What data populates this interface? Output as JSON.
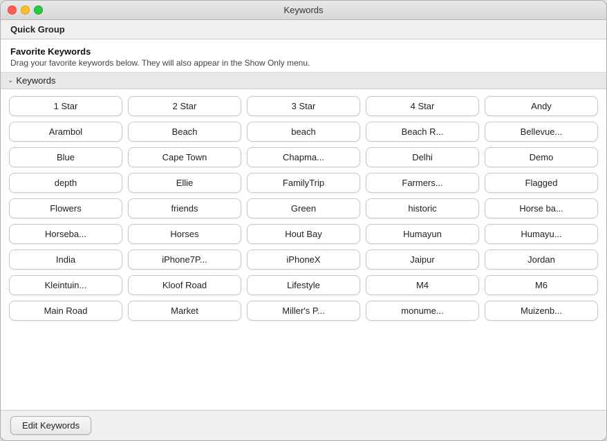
{
  "window": {
    "title": "Keywords"
  },
  "quick_group": {
    "label": "Quick Group"
  },
  "favorite_keywords": {
    "title": "Favorite Keywords",
    "description": "Drag your favorite keywords below. They will also appear in the Show Only menu."
  },
  "keywords_section": {
    "label": "Keywords",
    "chevron": "⌄"
  },
  "keywords": [
    "1 Star",
    "2 Star",
    "3 Star",
    "4 Star",
    "Andy",
    "Arambol",
    "Beach",
    "beach",
    "Beach R...",
    "Bellevue...",
    "Blue",
    "Cape Town",
    "Chapma...",
    "Delhi",
    "Demo",
    "depth",
    "Ellie",
    "FamilyTrip",
    "Farmers...",
    "Flagged",
    "Flowers",
    "friends",
    "Green",
    "historic",
    "Horse ba...",
    "Horseba...",
    "Horses",
    "Hout Bay",
    "Humayun",
    "Humayu...",
    "India",
    "iPhone7P...",
    "iPhoneX",
    "Jaipur",
    "Jordan",
    "Kleintuin...",
    "Kloof Road",
    "Lifestyle",
    "M4",
    "M6",
    "Main Road",
    "Market",
    "Miller's P...",
    "monume...",
    "Muizenb..."
  ],
  "footer": {
    "edit_button_label": "Edit Keywords"
  }
}
